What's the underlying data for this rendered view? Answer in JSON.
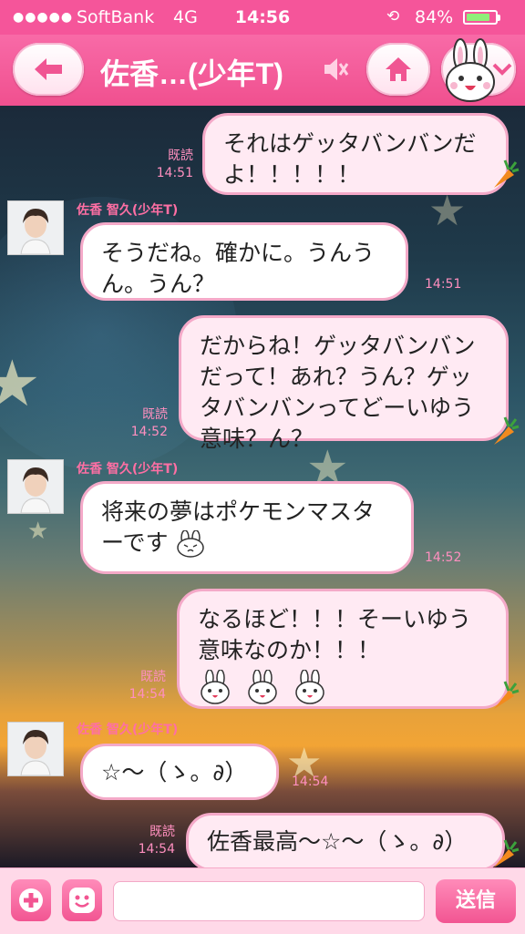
{
  "status": {
    "signal": "●●●●●",
    "carrier": "SoftBank",
    "network": "4G",
    "time": "14:56",
    "battery_pct": "84%",
    "battery_level": 0.84
  },
  "header": {
    "title": "佐香…(少年T)",
    "back_icon": "arrow-left-icon",
    "mute_icon": "speaker-mute-icon",
    "home_icon": "home-icon",
    "menu_icon": "chevron-down-icon"
  },
  "sender_name": "佐香 智久(少年T)",
  "messages": [
    {
      "dir": "out",
      "text": "それはゲッタバンバンだよ！！！！！",
      "read": "既読",
      "time": "14:51"
    },
    {
      "dir": "in",
      "text": "そうだね。確かに。うんうん。うん？",
      "time": "14:51"
    },
    {
      "dir": "out",
      "text": "だからね！ゲッタバンバンだって！あれ？うん？ゲッタバンバンってどーいゆう意味？ん？",
      "read": "既読",
      "time": "14:52"
    },
    {
      "dir": "in",
      "text": "将来の夢はポケモンマスターです",
      "time": "14:52"
    },
    {
      "dir": "out",
      "text": "なるほど！！！そーいゆう意味なのか！！！",
      "read": "既読",
      "time": "14:54"
    },
    {
      "dir": "in",
      "text": "☆〜（ゝ。∂）",
      "time": "14:54"
    },
    {
      "dir": "out",
      "text": "佐香最高〜☆〜（ゝ。∂）",
      "read": "既読",
      "time": "14:54"
    }
  ],
  "input": {
    "placeholder": "",
    "value": "",
    "send_label": "送信"
  },
  "colors": {
    "brand_pink": "#f5559a",
    "bubble_border": "#f4a9c8",
    "out_bubble": "#ffeaf3"
  }
}
